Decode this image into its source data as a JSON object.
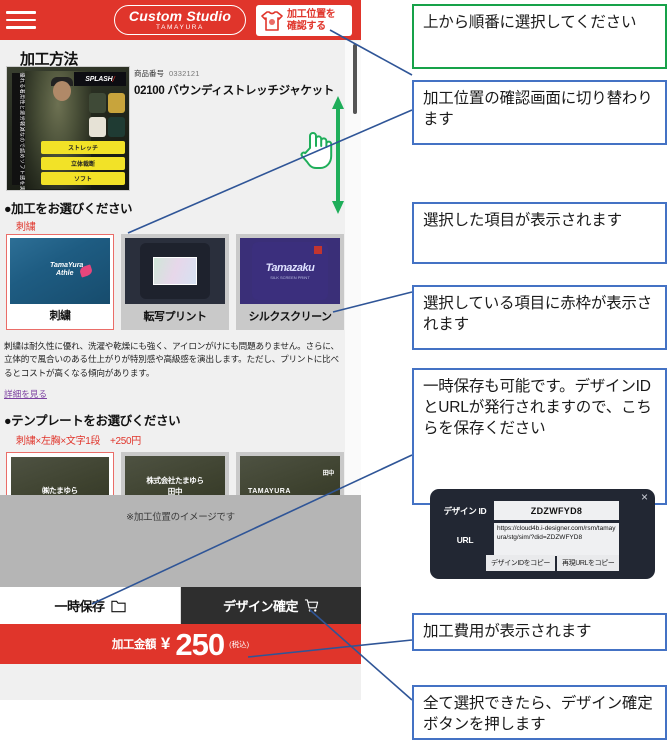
{
  "app": {
    "header": {
      "menu_icon": "hamburger-menu-icon",
      "brand_main": "Custom Studio",
      "brand_sub": "TAMAYURA",
      "check_button_line1": "加工位置を",
      "check_button_line2": "確認する",
      "check_button_icon": "tshirt-icon",
      "bg_color": "#e0352b"
    },
    "section_title": "加工方法",
    "product": {
      "number_label": "商品番号",
      "number_value": "0332121",
      "name": "02100 バウンディストレッチジャケット",
      "image_tags": [
        "ストレッチ",
        "立体裁断",
        "ソフト"
      ],
      "image_brand": "SPLASH",
      "image_side_text": "優れる着用性と疲労軽減なので認めソフト感を実現"
    },
    "processing": {
      "heading": "●加工をお選びください",
      "selected": "刺繍",
      "options": [
        {
          "label": "刺繍",
          "selected": true,
          "thumb": "embroidery-hoodie-thumb",
          "thumb_text_1": "TamaYura",
          "thumb_text_2": "Athle"
        },
        {
          "label": "転写プリント",
          "selected": false,
          "thumb": "transfer-print-tee-thumb"
        },
        {
          "label": "シルクスクリーン",
          "selected": false,
          "thumb": "silkscreen-tee-thumb",
          "thumb_text_1": "Tamazaku",
          "thumb_text_2": "SILK SCREEN PRINT"
        }
      ],
      "description": "刺繍は耐久性に優れ、洗濯や乾燥にも強く、アイロンがけにも問題ありません。さらに、立体的で風合いのある仕上がりが特別感や高級感を演出します。ただし、プリントに比べるとコストが高くなる傾向があります。",
      "detail_link": "詳細を見る"
    },
    "template": {
      "heading": "●テンプレートをお選びください",
      "selected": "刺繍×左胸×文字1段　+250円",
      "options": [
        {
          "selected": true,
          "line1": "㈱たまゆら",
          "line2": ""
        },
        {
          "selected": false,
          "line1": "株式会社たまゆら",
          "line2": "田中"
        },
        {
          "selected": false,
          "line1": "TAMAYURA",
          "line2": "田中"
        }
      ]
    },
    "preview_note": "※加工位置のイメージです",
    "actions": {
      "save_label": "一時保存",
      "save_icon": "folder-icon",
      "confirm_label": "デザイン確定",
      "confirm_icon": "cart-icon"
    },
    "price": {
      "label": "加工金額",
      "currency": "¥",
      "amount": "250",
      "tax_note": "(税込)"
    },
    "scroll_hint_icon": "hand-pointer-icon",
    "scroll_arrow_icon": "up-down-arrow-icon",
    "scrollbar_name": "vertical-scrollbar"
  },
  "popup": {
    "close_icon": "close-icon",
    "id_label": "デザイン ID",
    "id_value": "ZDZWFYD8",
    "url_label": "URL",
    "url_value": "https://cloud4b.i-designer.com/rsm/tamayura/stg/sim/?did=ZDZWFYD8",
    "copy_id_label": "デザインIDをコピー",
    "copy_url_label": "再現URLをコピー"
  },
  "annotations": [
    {
      "text": "上から順番に選択してください",
      "color": "#17a249"
    },
    {
      "text": "加工位置の確認画面に切り替わります",
      "color": "#4472c4"
    },
    {
      "text": "選択した項目が表示されます",
      "color": "#4472c4"
    },
    {
      "text": "選択している項目に赤枠が表示されます",
      "color": "#4472c4"
    },
    {
      "text": "一時保存も可能です。デザインIDとURLが発行されますので、こちらを保存ください",
      "color": "#4472c4"
    },
    {
      "text": "加工費用が表示されます",
      "color": "#4472c4"
    },
    {
      "text": "全て選択できたら、デザイン確定ボタンを押します",
      "color": "#4472c4"
    }
  ]
}
